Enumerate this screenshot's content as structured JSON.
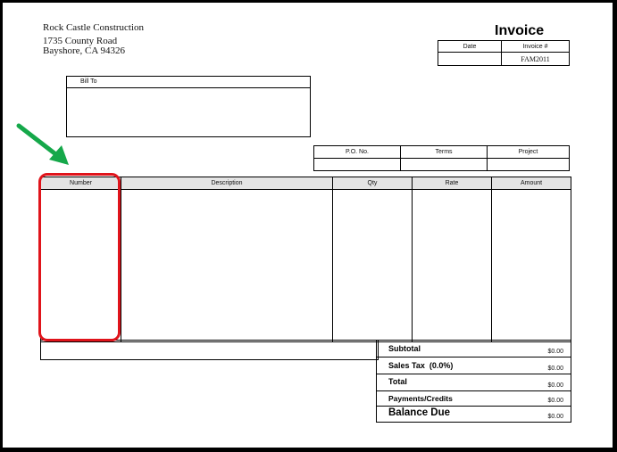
{
  "company": {
    "name": "Rock Castle Construction",
    "address_line1": "1735 County Road",
    "address_line2": "Bayshore, CA 94326"
  },
  "title": "Invoice",
  "header_box": {
    "date_label": "Date",
    "invoice_num_label": "Invoice #",
    "date_value": "",
    "invoice_num_value": "FAM2011"
  },
  "bill_to": {
    "label": "Bill To"
  },
  "po_table": {
    "po_label": "P.O. No.",
    "terms_label": "Terms",
    "project_label": "Project"
  },
  "line_items": {
    "number_label": "Number",
    "description_label": "Description",
    "qty_label": "Qty",
    "rate_label": "Rate",
    "amount_label": "Amount"
  },
  "totals": {
    "subtotal_label": "Subtotal",
    "subtotal_value": "$0.00",
    "sales_tax_label": "Sales Tax  (0.0%)",
    "sales_tax_value": "$0.00",
    "total_label": "Total",
    "total_value": "$0.00",
    "payments_label": "Payments/Credits",
    "payments_value": "$0.00",
    "balance_label": "Balance Due",
    "balance_value": "$0.00"
  },
  "annotation": {
    "arrow_color": "#15a84a",
    "highlight_color": "#e0141b"
  }
}
